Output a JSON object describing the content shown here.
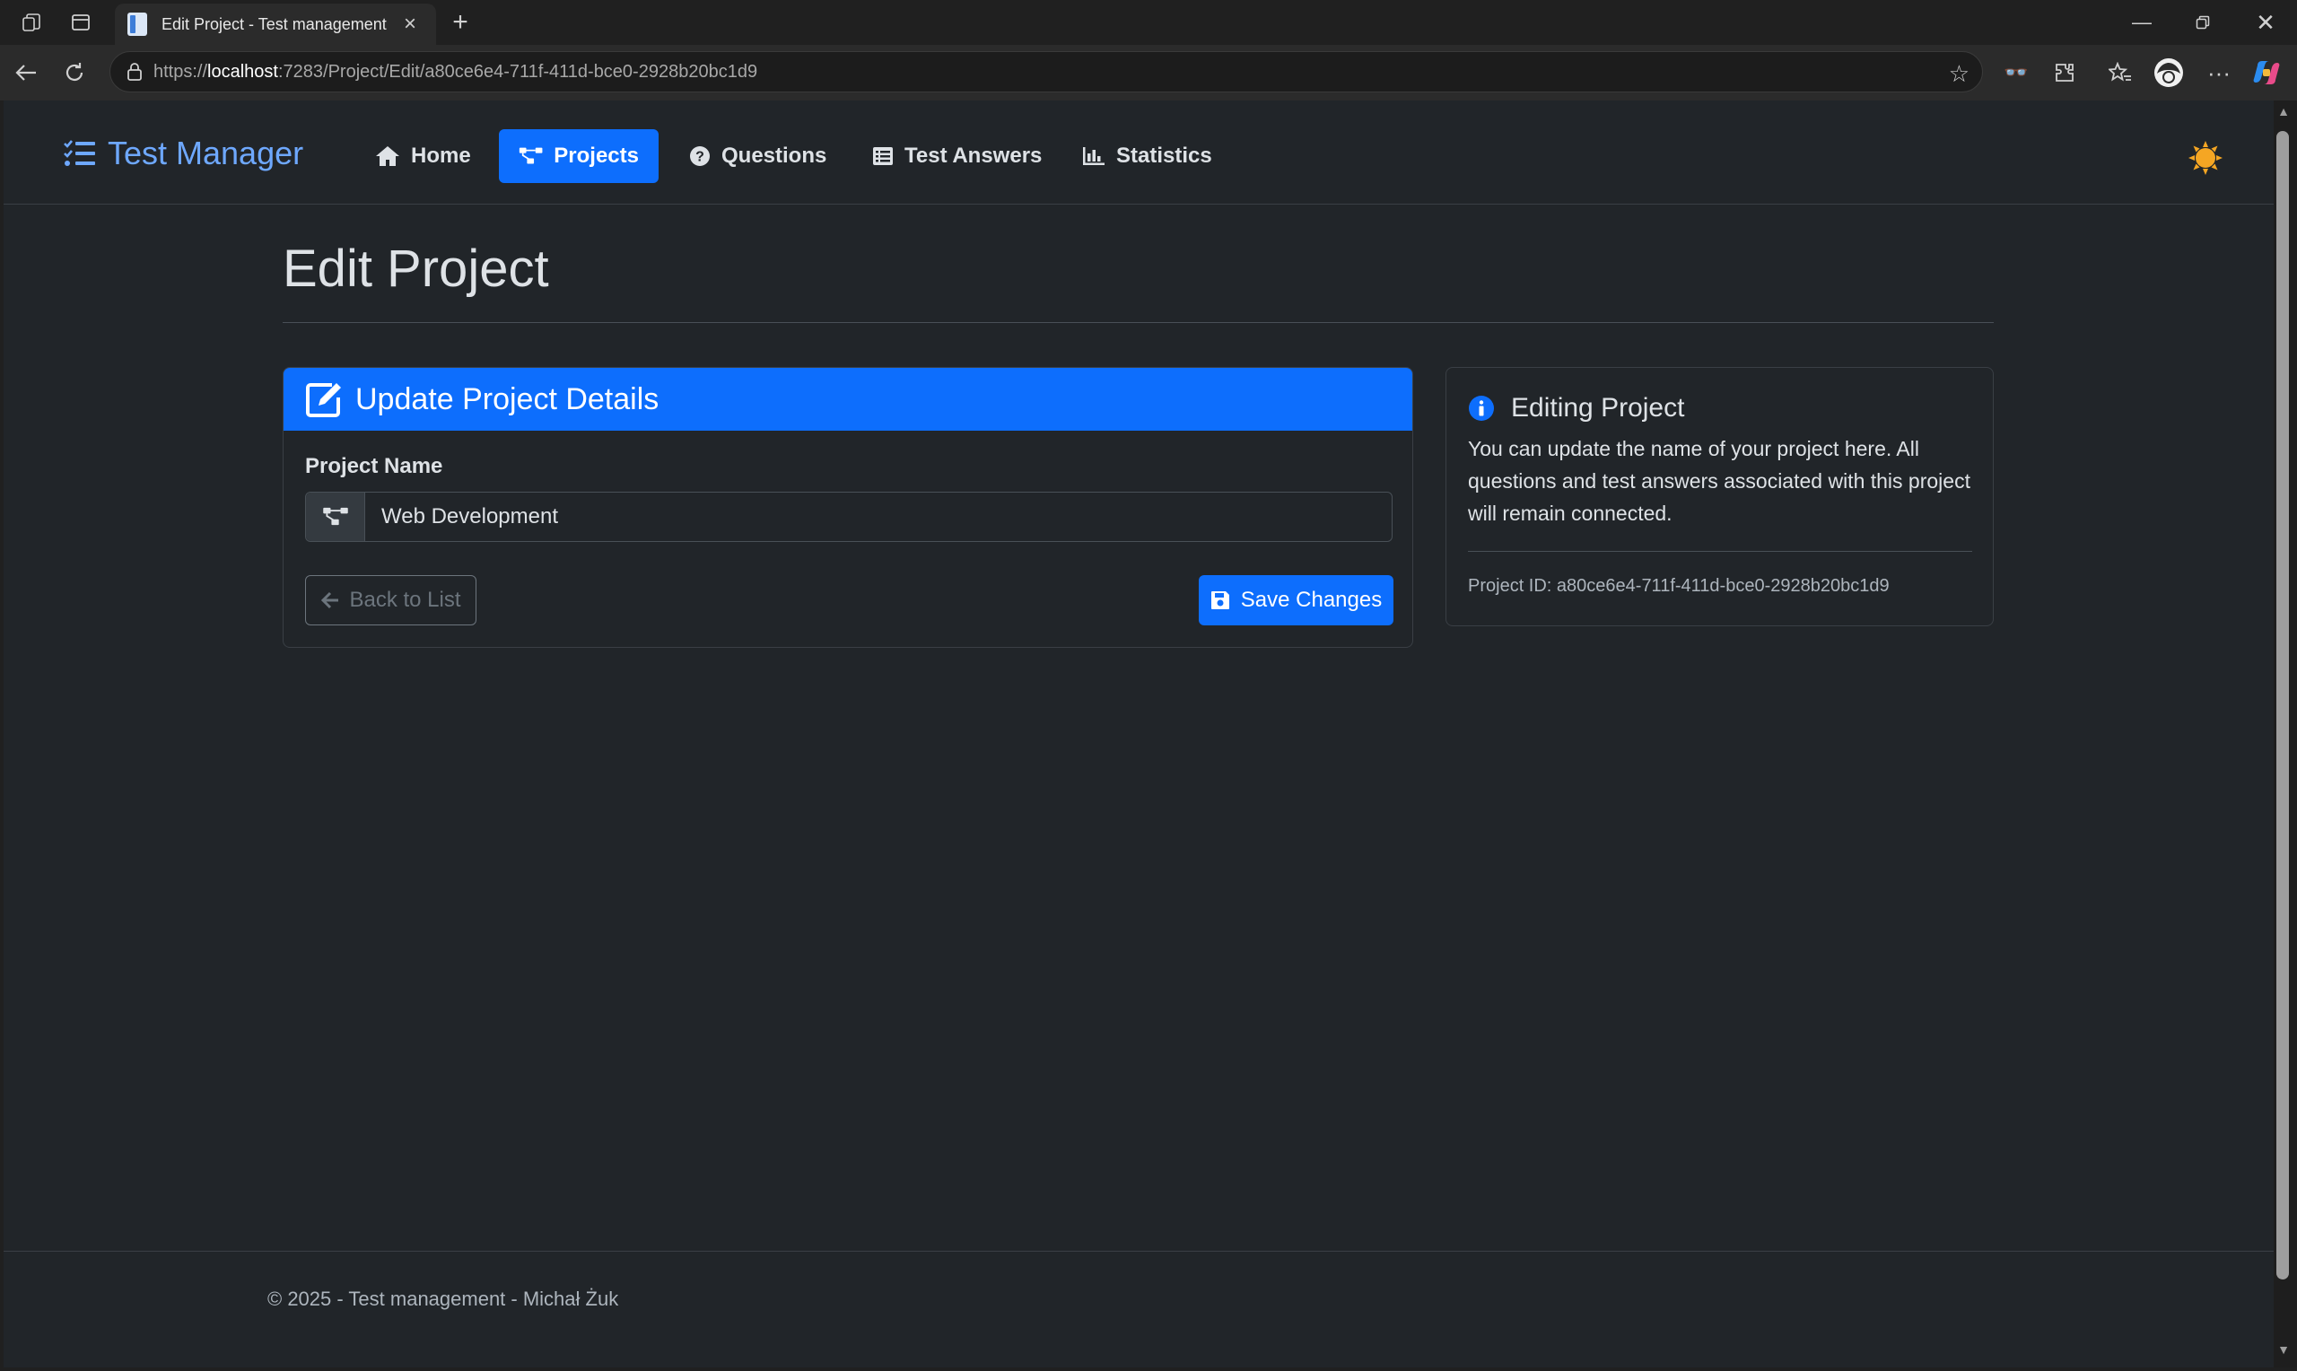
{
  "browser": {
    "tab_title": "Edit Project - Test management",
    "url_prefix": "https://",
    "url_host": "localhost",
    "url_rest": ":7283/Project/Edit/a80ce6e4-711f-411d-bce0-2928b20bc1d9"
  },
  "nav": {
    "brand": "Test Manager",
    "items": [
      {
        "label": "Home",
        "icon": "home-icon"
      },
      {
        "label": "Projects",
        "icon": "project-diagram-icon",
        "active": true
      },
      {
        "label": "Questions",
        "icon": "question-circle-icon"
      },
      {
        "label": "Test Answers",
        "icon": "list-alt-icon"
      },
      {
        "label": "Statistics",
        "icon": "chart-bar-icon"
      }
    ]
  },
  "page": {
    "title": "Edit Project"
  },
  "form": {
    "header": "Update Project Details",
    "project_name_label": "Project Name",
    "project_name_value": "Web Development",
    "back_label": "Back to List",
    "save_label": "Save Changes"
  },
  "info": {
    "heading": "Editing Project",
    "text": "You can update the name of your project here. All questions and test answers associated with this project will remain connected.",
    "project_id": "Project ID: a80ce6e4-711f-411d-bce0-2928b20bc1d9"
  },
  "footer": {
    "text": "© 2025 - Test management - Michał Żuk"
  },
  "colors": {
    "primary": "#0d6efd",
    "brand": "#6ea8fe",
    "page_bg": "#212529",
    "theme_toggle": "#f5a623"
  }
}
